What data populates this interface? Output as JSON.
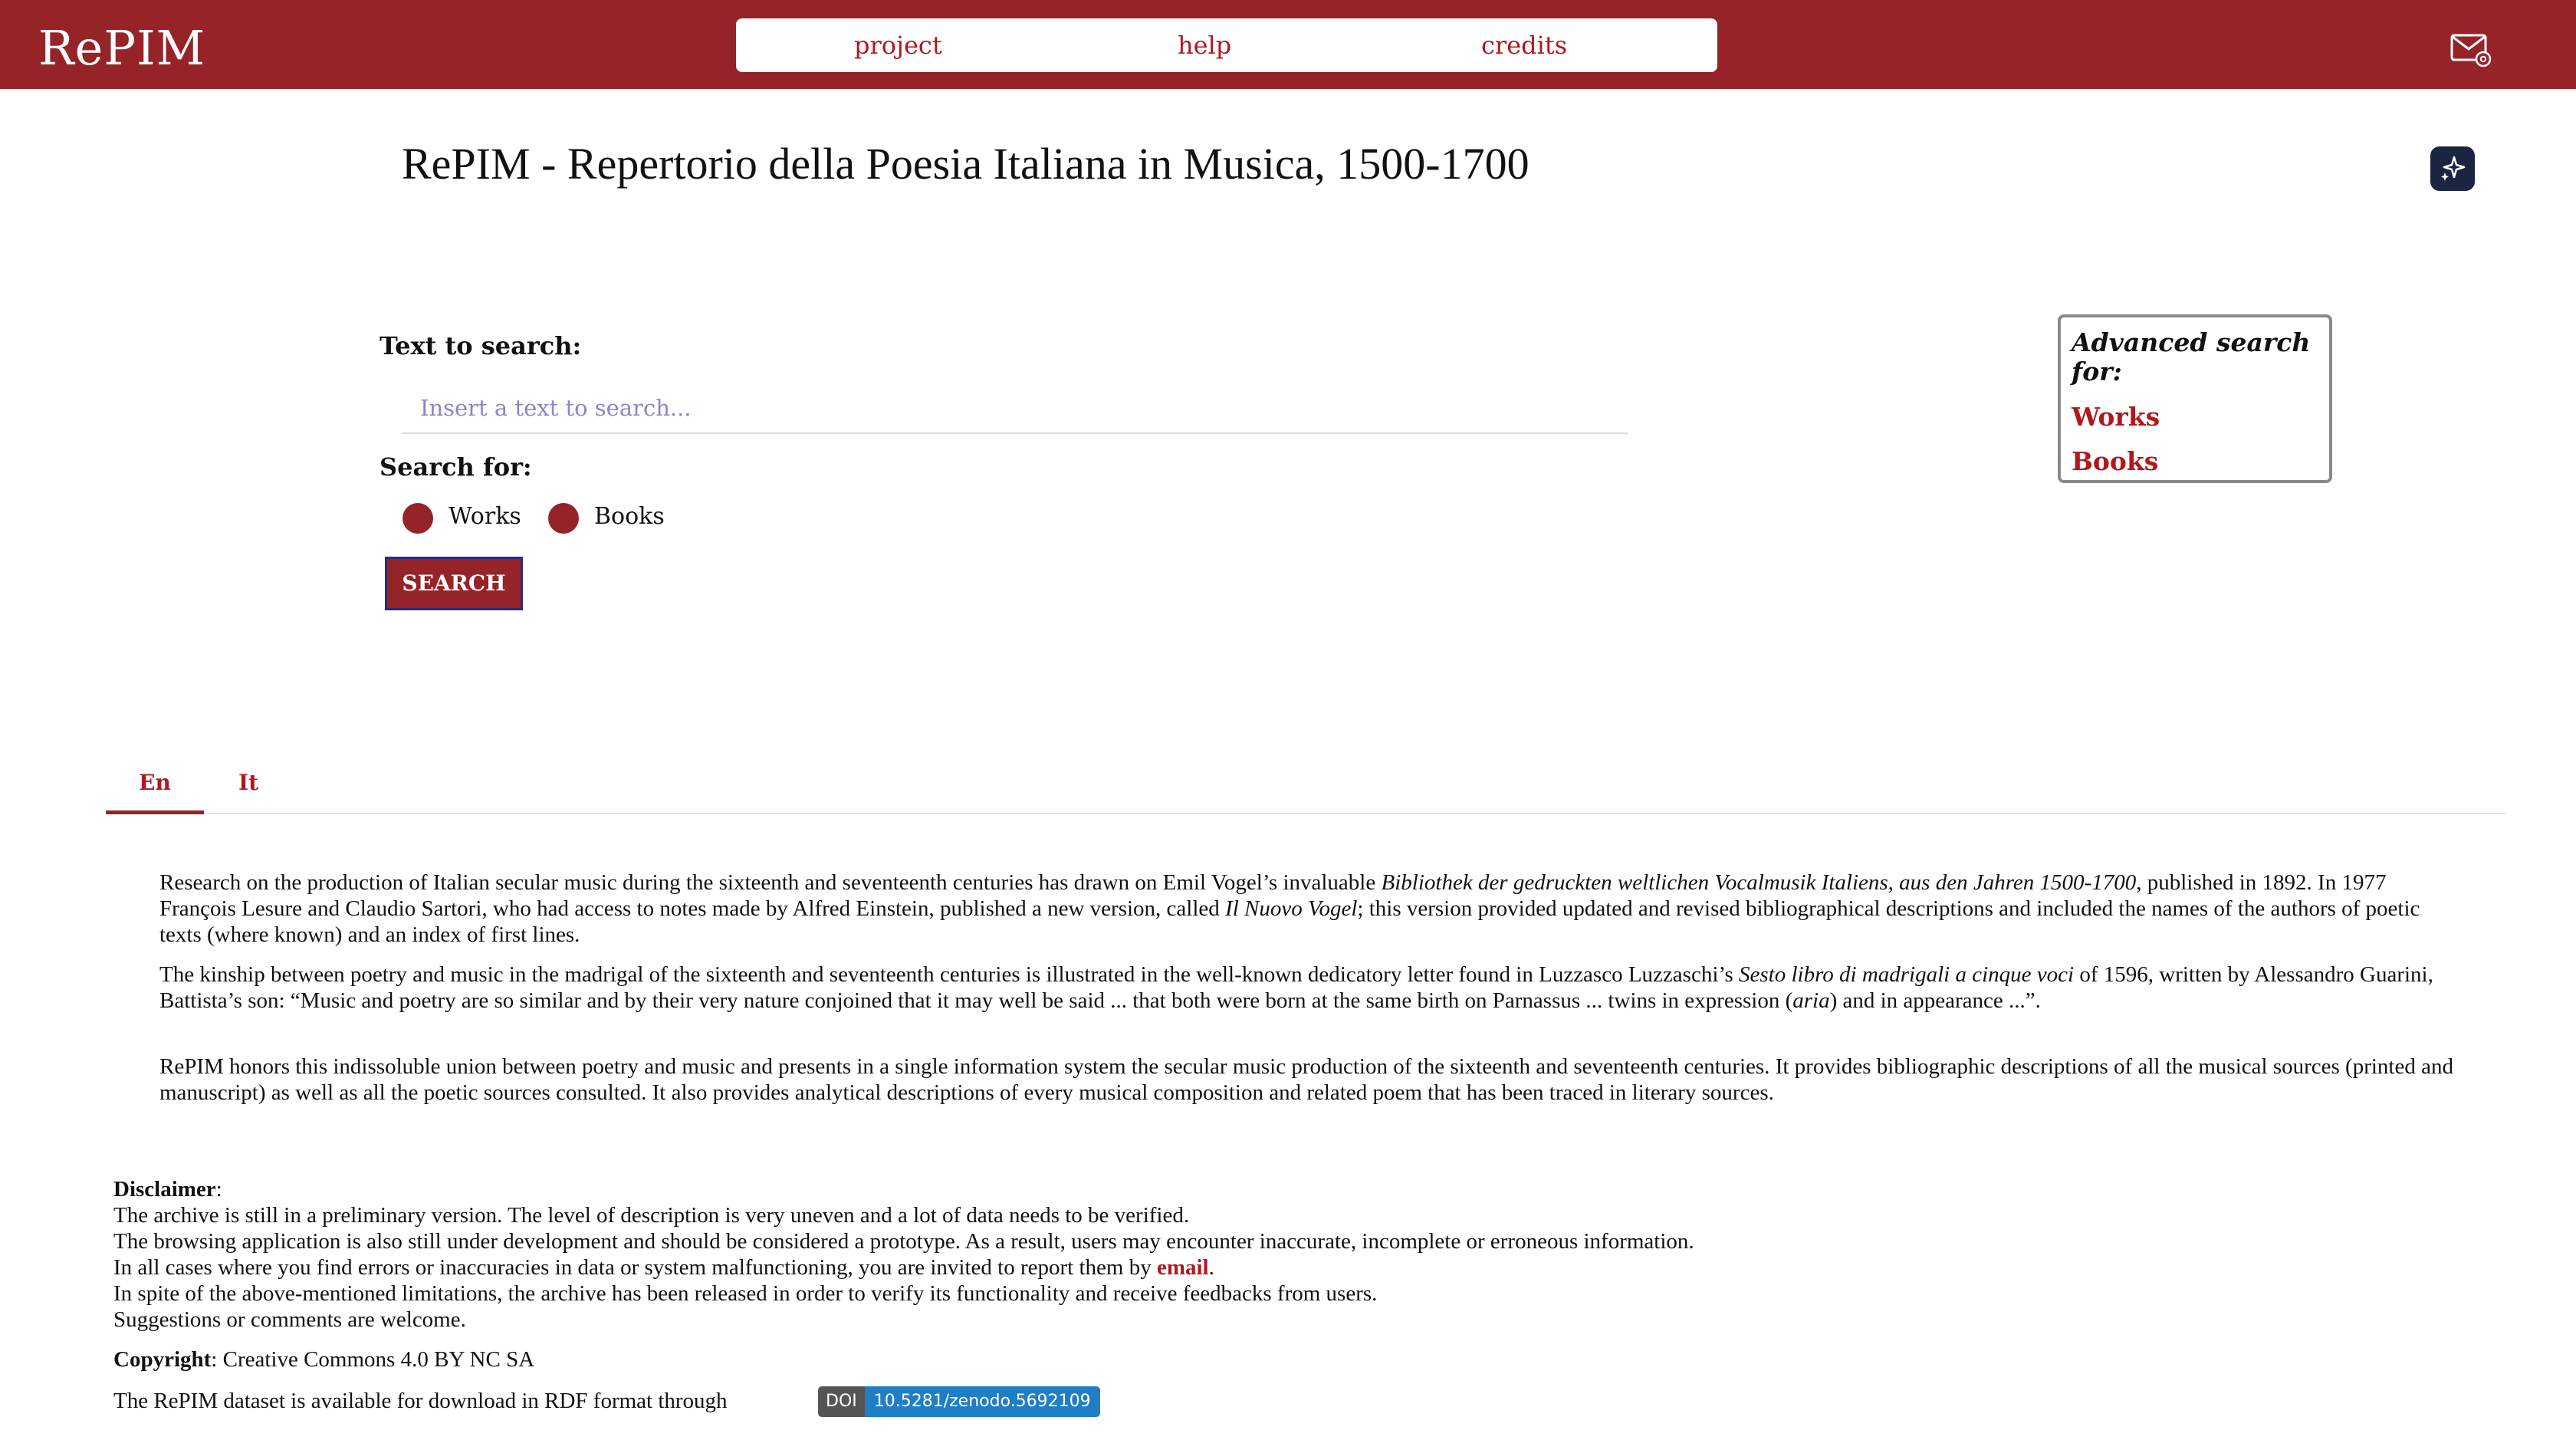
{
  "brand": "RePIM",
  "nav": {
    "project": "project",
    "help": "help",
    "credits": "credits"
  },
  "icons": {
    "mail": "mail-at-icon",
    "assistant": "sparkle-icon"
  },
  "colors": {
    "brand": "#962328",
    "link": "#b0181e",
    "placeholder": "#8a86c4",
    "doi_left": "#555555",
    "doi_right": "#1f7ec5"
  },
  "title": "RePIM - Repertorio della Poesia Italiana in Musica, 1500-1700",
  "search": {
    "text_label": "Text to search:",
    "placeholder": "Insert a text to search...",
    "value": "",
    "search_for_label": "Search for:",
    "options": [
      "Works",
      "Books"
    ],
    "button": "SEARCH"
  },
  "advanced": {
    "title": "Advanced search for:",
    "links": [
      "Works",
      "Books"
    ]
  },
  "tabs": [
    "En",
    "It"
  ],
  "intro": {
    "p1": {
      "a": "Research on the production of Italian secular music during the sixteenth and seventeenth centuries has drawn on Emil Vogel’s invaluable ",
      "b": "Bibliothek der gedruckten weltlichen Vocalmusik Italiens, aus den Jahren 1500-1700",
      "c": ", published in 1892. In 1977 François Lesure and Claudio Sartori, who had access to notes made by Alfred Einstein, published a new version, called ",
      "d": "Il Nuovo Vogel",
      "e": "; this version provided updated and revised bibliographical descriptions and included the names of the authors of poetic texts (where known) and an index of first lines."
    },
    "p2": {
      "a": "The kinship between poetry and music in the madrigal of the sixteenth and seventeenth centuries is illustrated in the well-known dedicatory letter found in Luzzasco Luzzaschi’s ",
      "b": "Sesto libro di madrigali a cinque voci",
      "c": " of 1596, written by Alessandro Guarini, Battista’s son: “Music and poetry are so similar and by their very nature conjoined that it may well be said ... that both were born at the same birth on Parnassus ... twins in expression (",
      "d": "aria",
      "e": ") and in appearance ...”."
    },
    "p3": "RePIM honors this indissoluble union between poetry and music and presents in a single information system the secular music production of the sixteenth and seventeenth centuries. It provides bibliographic descriptions of all the musical sources (printed and manuscript) as well as all the poetic sources consulted. It also provides analytical descriptions of every musical composition and related poem that has been traced in literary sources."
  },
  "disclaimer": {
    "label": "Disclaimer",
    "colon": ":",
    "l1": "The archive is still in a preliminary version.  The level of description is very uneven and a lot of data needs to be verified.",
    "l2": "The browsing application is also still under development and should be considered a prototype.  As a result, users may encounter inaccurate, incomplete or erroneous information.",
    "l3_pre": "In all cases where you find errors or inaccuracies in data or system malfunctioning, you are invited to report them by ",
    "l3_link": "email",
    "l3_post": ".",
    "l4": "In spite of the above-mentioned limitations, the archive has been released in order to verify its functionality and receive feedbacks from users.",
    "l5": "Suggestions or comments are welcome."
  },
  "copyright": {
    "label": "Copyright",
    "text": ": Creative Commons 4.0 BY NC SA"
  },
  "dataset": {
    "text": "The RePIM dataset is available for download in RDF format through",
    "doi_label": "DOI",
    "doi_value": "10.5281/zenodo.5692109"
  }
}
